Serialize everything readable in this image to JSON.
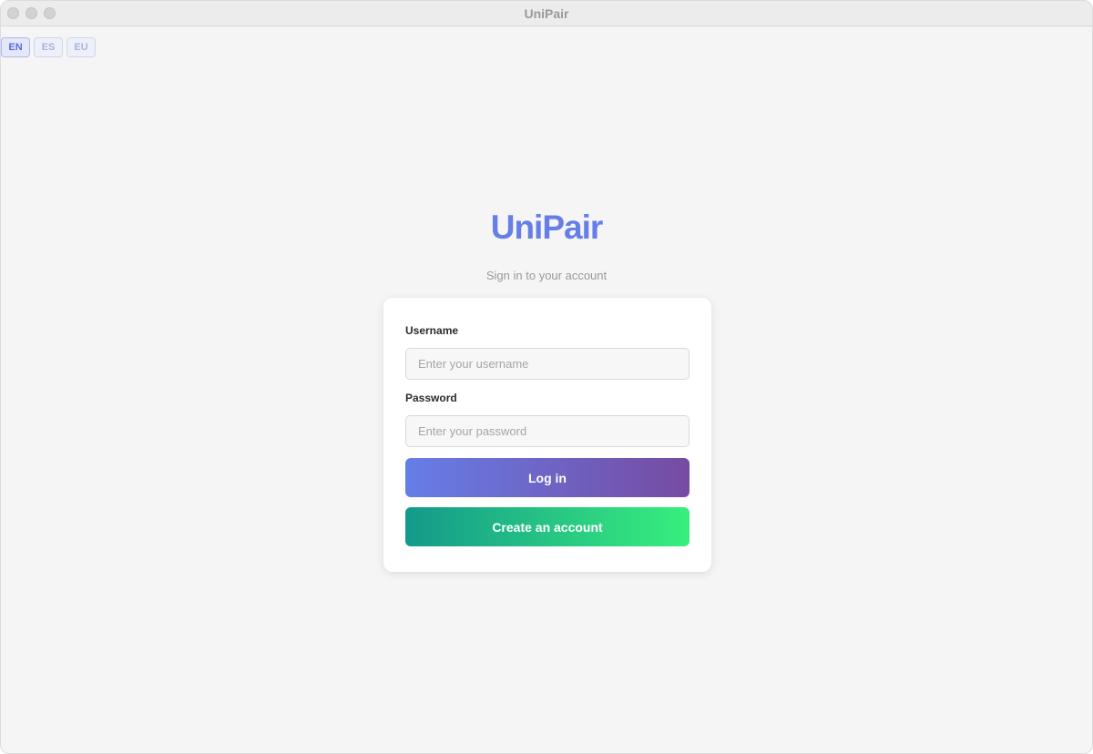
{
  "window": {
    "title": "UniPair"
  },
  "languages": [
    {
      "code": "EN",
      "active": true
    },
    {
      "code": "ES",
      "active": false
    },
    {
      "code": "EU",
      "active": false
    }
  ],
  "brand": {
    "name": "UniPair",
    "subtitle": "Sign in to your account"
  },
  "login_form": {
    "username_label": "Username",
    "username_placeholder": "Enter your username",
    "username_value": "",
    "password_label": "Password",
    "password_placeholder": "Enter your password",
    "password_value": "",
    "login_button": "Log in",
    "create_account_button": "Create an account"
  },
  "colors": {
    "brand": "#667ee8",
    "login_gradient_start": "#667ee8",
    "login_gradient_end": "#764ba2",
    "create_gradient_start": "#14998a",
    "create_gradient_end": "#38ef7d",
    "background": "#f5f5f5"
  }
}
